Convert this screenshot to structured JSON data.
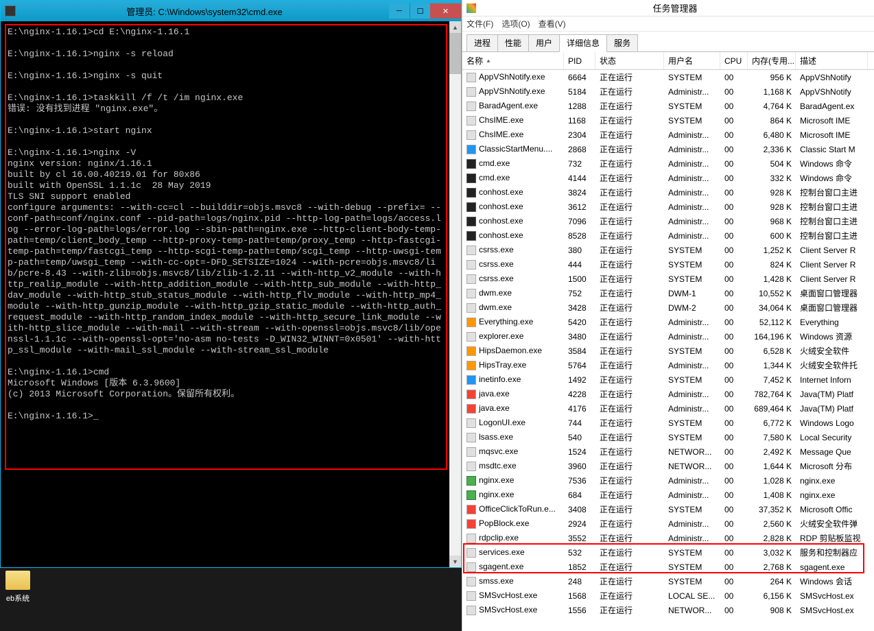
{
  "cmd": {
    "title": "管理员: C:\\Windows\\system32\\cmd.exe",
    "text": "E:\\nginx-1.16.1>cd E:\\nginx-1.16.1\n\nE:\\nginx-1.16.1>nginx -s reload\n\nE:\\nginx-1.16.1>nginx -s quit\n\nE:\\nginx-1.16.1>taskkill /f /t /im nginx.exe\n错误: 没有找到进程 \"nginx.exe\"。\n\nE:\\nginx-1.16.1>start nginx\n\nE:\\nginx-1.16.1>nginx -V\nnginx version: nginx/1.16.1\nbuilt by cl 16.00.40219.01 for 80x86\nbuilt with OpenSSL 1.1.1c  28 May 2019\nTLS SNI support enabled\nconfigure arguments: --with-cc=cl --builddir=objs.msvc8 --with-debug --prefix= --conf-path=conf/nginx.conf --pid-path=logs/nginx.pid --http-log-path=logs/access.log --error-log-path=logs/error.log --sbin-path=nginx.exe --http-client-body-temp-path=temp/client_body_temp --http-proxy-temp-path=temp/proxy_temp --http-fastcgi-temp-path=temp/fastcgi_temp --http-scgi-temp-path=temp/scgi_temp --http-uwsgi-temp-path=temp/uwsgi_temp --with-cc-opt=-DFD_SETSIZE=1024 --with-pcre=objs.msvc8/lib/pcre-8.43 --with-zlib=objs.msvc8/lib/zlib-1.2.11 --with-http_v2_module --with-http_realip_module --with-http_addition_module --with-http_sub_module --with-http_dav_module --with-http_stub_status_module --with-http_flv_module --with-http_mp4_module --with-http_gunzip_module --with-http_gzip_static_module --with-http_auth_request_module --with-http_random_index_module --with-http_secure_link_module --with-http_slice_module --with-mail --with-stream --with-openssl=objs.msvc8/lib/openssl-1.1.1c --with-openssl-opt='no-asm no-tests -D_WIN32_WINNT=0x0501' --with-http_ssl_module --with-mail_ssl_module --with-stream_ssl_module\n\nE:\\nginx-1.16.1>cmd\nMicrosoft Windows [版本 6.3.9600]\n(c) 2013 Microsoft Corporation。保留所有权利。\n\nE:\\nginx-1.16.1>_"
  },
  "desktop": {
    "icon_label": "eb系统"
  },
  "tm": {
    "title": "任务管理器",
    "menus": [
      "文件(F)",
      "选项(O)",
      "查看(V)"
    ],
    "tabs": [
      "进程",
      "性能",
      "用户",
      "详细信息",
      "服务"
    ],
    "active_tab": 3,
    "columns": [
      "名称",
      "PID",
      "状态",
      "用户名",
      "CPU",
      "内存(专用...",
      "描述"
    ],
    "rows": [
      {
        "icon": "",
        "name": "AppVShNotify.exe",
        "pid": "6664",
        "status": "正在运行",
        "user": "SYSTEM",
        "cpu": "00",
        "mem": "956 K",
        "desc": "AppVShNotify"
      },
      {
        "icon": "",
        "name": "AppVShNotify.exe",
        "pid": "5184",
        "status": "正在运行",
        "user": "Administr...",
        "cpu": "00",
        "mem": "1,168 K",
        "desc": "AppVShNotify"
      },
      {
        "icon": "",
        "name": "BaradAgent.exe",
        "pid": "1288",
        "status": "正在运行",
        "user": "SYSTEM",
        "cpu": "00",
        "mem": "4,764 K",
        "desc": "BaradAgent.ex"
      },
      {
        "icon": "",
        "name": "ChsIME.exe",
        "pid": "1168",
        "status": "正在运行",
        "user": "SYSTEM",
        "cpu": "00",
        "mem": "864 K",
        "desc": "Microsoft IME"
      },
      {
        "icon": "",
        "name": "ChsIME.exe",
        "pid": "2304",
        "status": "正在运行",
        "user": "Administr...",
        "cpu": "00",
        "mem": "6,480 K",
        "desc": "Microsoft IME"
      },
      {
        "icon": "blue",
        "name": "ClassicStartMenu....",
        "pid": "2868",
        "status": "正在运行",
        "user": "Administr...",
        "cpu": "00",
        "mem": "2,336 K",
        "desc": "Classic Start M"
      },
      {
        "icon": "cmd",
        "name": "cmd.exe",
        "pid": "732",
        "status": "正在运行",
        "user": "Administr...",
        "cpu": "00",
        "mem": "504 K",
        "desc": "Windows 命令"
      },
      {
        "icon": "cmd",
        "name": "cmd.exe",
        "pid": "4144",
        "status": "正在运行",
        "user": "Administr...",
        "cpu": "00",
        "mem": "332 K",
        "desc": "Windows 命令"
      },
      {
        "icon": "cmd",
        "name": "conhost.exe",
        "pid": "3824",
        "status": "正在运行",
        "user": "Administr...",
        "cpu": "00",
        "mem": "928 K",
        "desc": "控制台窗口主进"
      },
      {
        "icon": "cmd",
        "name": "conhost.exe",
        "pid": "3612",
        "status": "正在运行",
        "user": "Administr...",
        "cpu": "00",
        "mem": "928 K",
        "desc": "控制台窗口主进"
      },
      {
        "icon": "cmd",
        "name": "conhost.exe",
        "pid": "7096",
        "status": "正在运行",
        "user": "Administr...",
        "cpu": "00",
        "mem": "968 K",
        "desc": "控制台窗口主进"
      },
      {
        "icon": "cmd",
        "name": "conhost.exe",
        "pid": "8528",
        "status": "正在运行",
        "user": "Administr...",
        "cpu": "00",
        "mem": "600 K",
        "desc": "控制台窗口主进"
      },
      {
        "icon": "",
        "name": "csrss.exe",
        "pid": "380",
        "status": "正在运行",
        "user": "SYSTEM",
        "cpu": "00",
        "mem": "1,252 K",
        "desc": "Client Server R"
      },
      {
        "icon": "",
        "name": "csrss.exe",
        "pid": "444",
        "status": "正在运行",
        "user": "SYSTEM",
        "cpu": "00",
        "mem": "824 K",
        "desc": "Client Server R"
      },
      {
        "icon": "",
        "name": "csrss.exe",
        "pid": "1500",
        "status": "正在运行",
        "user": "SYSTEM",
        "cpu": "00",
        "mem": "1,428 K",
        "desc": "Client Server R"
      },
      {
        "icon": "",
        "name": "dwm.exe",
        "pid": "752",
        "status": "正在运行",
        "user": "DWM-1",
        "cpu": "00",
        "mem": "10,552 K",
        "desc": "桌面窗口管理器"
      },
      {
        "icon": "",
        "name": "dwm.exe",
        "pid": "3428",
        "status": "正在运行",
        "user": "DWM-2",
        "cpu": "00",
        "mem": "34,064 K",
        "desc": "桌面窗口管理器"
      },
      {
        "icon": "orange",
        "name": "Everything.exe",
        "pid": "5420",
        "status": "正在运行",
        "user": "Administr...",
        "cpu": "00",
        "mem": "52,112 K",
        "desc": "Everything"
      },
      {
        "icon": "",
        "name": "explorer.exe",
        "pid": "3480",
        "status": "正在运行",
        "user": "Administr...",
        "cpu": "00",
        "mem": "164,196 K",
        "desc": "Windows 资源"
      },
      {
        "icon": "orange",
        "name": "HipsDaemon.exe",
        "pid": "3584",
        "status": "正在运行",
        "user": "SYSTEM",
        "cpu": "00",
        "mem": "6,528 K",
        "desc": "火绒安全软件"
      },
      {
        "icon": "orange",
        "name": "HipsTray.exe",
        "pid": "5764",
        "status": "正在运行",
        "user": "Administr...",
        "cpu": "00",
        "mem": "1,344 K",
        "desc": "火绒安全软件托"
      },
      {
        "icon": "blue",
        "name": "inetinfo.exe",
        "pid": "1492",
        "status": "正在运行",
        "user": "SYSTEM",
        "cpu": "00",
        "mem": "7,452 K",
        "desc": "Internet Inforn"
      },
      {
        "icon": "java",
        "name": "java.exe",
        "pid": "4228",
        "status": "正在运行",
        "user": "Administr...",
        "cpu": "00",
        "mem": "782,764 K",
        "desc": "Java(TM) Platf"
      },
      {
        "icon": "java",
        "name": "java.exe",
        "pid": "4176",
        "status": "正在运行",
        "user": "Administr...",
        "cpu": "00",
        "mem": "689,464 K",
        "desc": "Java(TM) Platf"
      },
      {
        "icon": "",
        "name": "LogonUI.exe",
        "pid": "744",
        "status": "正在运行",
        "user": "SYSTEM",
        "cpu": "00",
        "mem": "6,772 K",
        "desc": "Windows Logo"
      },
      {
        "icon": "",
        "name": "lsass.exe",
        "pid": "540",
        "status": "正在运行",
        "user": "SYSTEM",
        "cpu": "00",
        "mem": "7,580 K",
        "desc": "Local Security"
      },
      {
        "icon": "",
        "name": "mqsvc.exe",
        "pid": "1524",
        "status": "正在运行",
        "user": "NETWOR...",
        "cpu": "00",
        "mem": "2,492 K",
        "desc": "Message Que"
      },
      {
        "icon": "",
        "name": "msdtc.exe",
        "pid": "3960",
        "status": "正在运行",
        "user": "NETWOR...",
        "cpu": "00",
        "mem": "1,644 K",
        "desc": "Microsoft 分布"
      },
      {
        "icon": "green",
        "name": "nginx.exe",
        "pid": "7536",
        "status": "正在运行",
        "user": "Administr...",
        "cpu": "00",
        "mem": "1,028 K",
        "desc": "nginx.exe",
        "hl": true
      },
      {
        "icon": "green",
        "name": "nginx.exe",
        "pid": "684",
        "status": "正在运行",
        "user": "Administr...",
        "cpu": "00",
        "mem": "1,408 K",
        "desc": "nginx.exe",
        "hl": true
      },
      {
        "icon": "red",
        "name": "OfficeClickToRun.e...",
        "pid": "3408",
        "status": "正在运行",
        "user": "SYSTEM",
        "cpu": "00",
        "mem": "37,352 K",
        "desc": "Microsoft Offic"
      },
      {
        "icon": "red",
        "name": "PopBlock.exe",
        "pid": "2924",
        "status": "正在运行",
        "user": "Administr...",
        "cpu": "00",
        "mem": "2,560 K",
        "desc": "火绒安全软件弹"
      },
      {
        "icon": "",
        "name": "rdpclip.exe",
        "pid": "3552",
        "status": "正在运行",
        "user": "Administr...",
        "cpu": "00",
        "mem": "2,828 K",
        "desc": "RDP 剪贴板监视"
      },
      {
        "icon": "",
        "name": "services.exe",
        "pid": "532",
        "status": "正在运行",
        "user": "SYSTEM",
        "cpu": "00",
        "mem": "3,032 K",
        "desc": "服务和控制器应"
      },
      {
        "icon": "",
        "name": "sgagent.exe",
        "pid": "1852",
        "status": "正在运行",
        "user": "SYSTEM",
        "cpu": "00",
        "mem": "2,768 K",
        "desc": "sgagent.exe"
      },
      {
        "icon": "",
        "name": "smss.exe",
        "pid": "248",
        "status": "正在运行",
        "user": "SYSTEM",
        "cpu": "00",
        "mem": "264 K",
        "desc": "Windows 会话"
      },
      {
        "icon": "",
        "name": "SMSvcHost.exe",
        "pid": "1568",
        "status": "正在运行",
        "user": "LOCAL SE...",
        "cpu": "00",
        "mem": "6,156 K",
        "desc": "SMSvcHost.ex"
      },
      {
        "icon": "",
        "name": "SMSvcHost.exe",
        "pid": "1556",
        "status": "正在运行",
        "user": "NETWOR...",
        "cpu": "00",
        "mem": "908 K",
        "desc": "SMSvcHost.ex"
      }
    ]
  }
}
